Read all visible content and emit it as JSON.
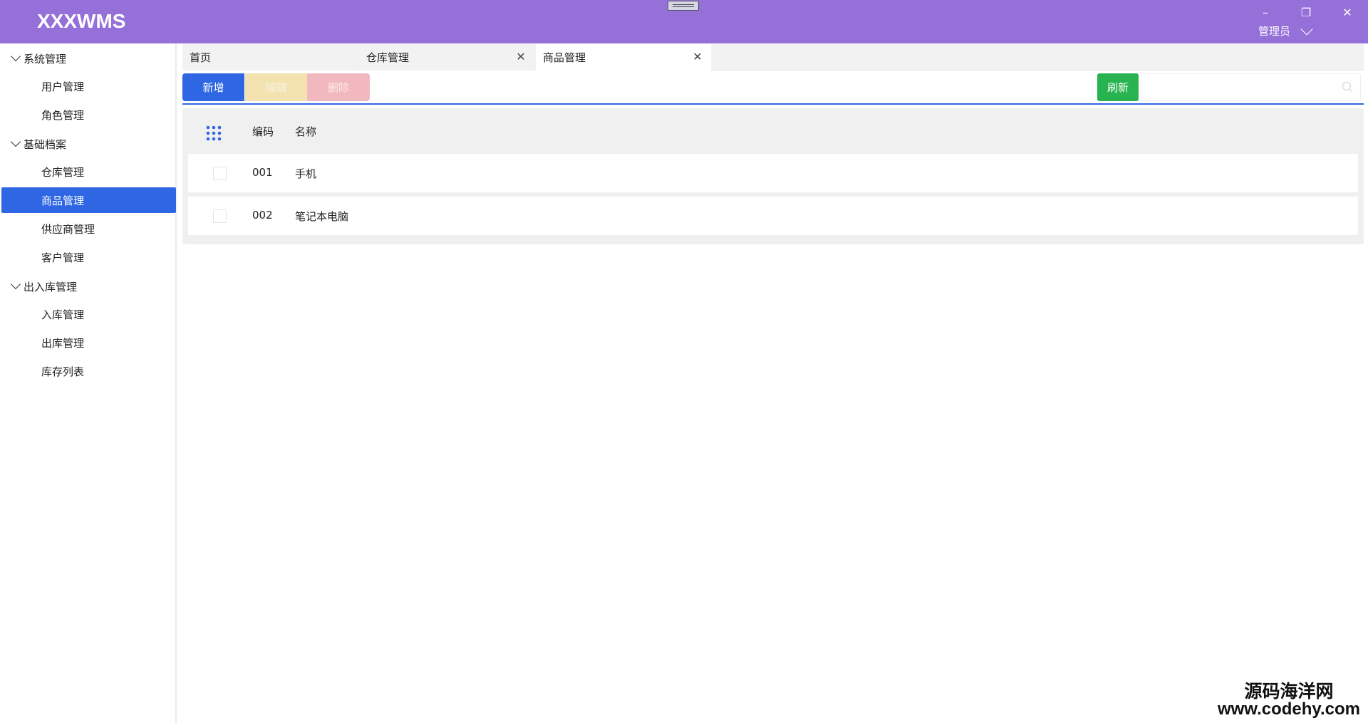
{
  "app": {
    "title": "XXXWMS",
    "user_label": "管理员",
    "window_controls": {
      "minimize": "–",
      "restore": "❐",
      "close": "✕"
    }
  },
  "sidebar": {
    "groups": [
      {
        "label": "系统管理",
        "items": [
          "用户管理",
          "角色管理"
        ]
      },
      {
        "label": "基础档案",
        "items": [
          "仓库管理",
          "商品管理",
          "供应商管理",
          "客户管理"
        ]
      },
      {
        "label": "出入库管理",
        "items": [
          "入库管理",
          "出库管理",
          "库存列表"
        ]
      }
    ],
    "active_item": "商品管理"
  },
  "tabs": [
    {
      "label": "首页",
      "closable": false,
      "active": false
    },
    {
      "label": "仓库管理",
      "closable": true,
      "active": false
    },
    {
      "label": "商品管理",
      "closable": true,
      "active": true
    }
  ],
  "toolbar": {
    "add_label": "新增",
    "edit_label": "编辑",
    "delete_label": "删除",
    "refresh_label": "刷新",
    "search_value": "",
    "search_placeholder": ""
  },
  "table": {
    "columns": [
      "编码",
      "名称"
    ],
    "rows": [
      {
        "code": "001",
        "name": "手机",
        "checked": false
      },
      {
        "code": "002",
        "name": "笔记本电脑",
        "checked": false
      }
    ]
  },
  "watermark": {
    "cn": "源码海洋网",
    "url": "www.codehy.com"
  },
  "colors": {
    "titlebar": "#9470d8",
    "primary": "#2f66e3",
    "add": "#2f66e3",
    "edit": "#f3e3b0",
    "delete": "#f2b8bf",
    "refresh": "#27b350"
  }
}
